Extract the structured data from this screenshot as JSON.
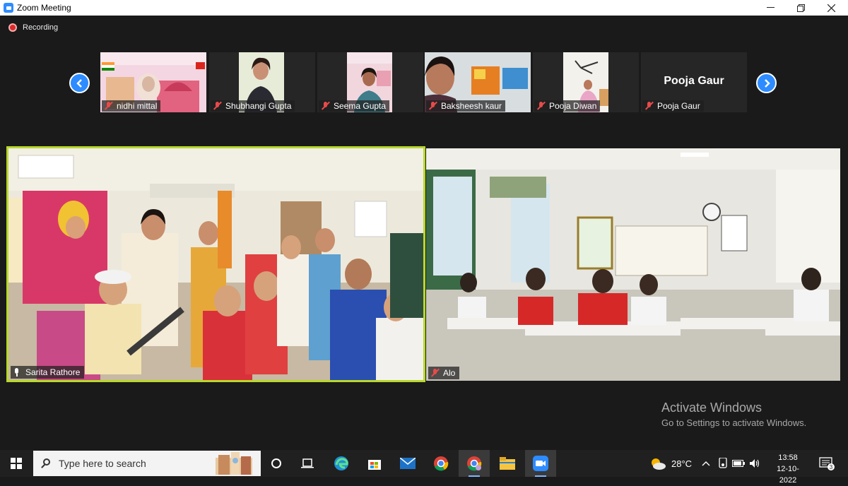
{
  "window": {
    "title": "Zoom Meeting"
  },
  "recording": {
    "label": "Recording"
  },
  "filmstrip": [
    {
      "name": "nidhi mittal"
    },
    {
      "name": "Shubhangi Gupta"
    },
    {
      "name": "Seema Gupta"
    },
    {
      "name": "Baksheesh kaur"
    },
    {
      "name": "Pooja Diwan"
    },
    {
      "name": "Pooja Gaur",
      "video_off_label": "Pooja Gaur"
    }
  ],
  "main": {
    "speaker": {
      "name": "Sarita Rathore",
      "border_color": "#b8d82c"
    },
    "other": {
      "name": "Alo"
    }
  },
  "watermark": {
    "line1": "Activate Windows",
    "line2": "Go to Settings to activate Windows."
  },
  "taskbar": {
    "search_placeholder": "Type here to search",
    "weather": "28°C",
    "time": "13:58",
    "date": "12-10-2022",
    "notifications": "3"
  },
  "colors": {
    "accent": "#2d8cff",
    "recording": "#e02828",
    "active_speaker": "#b8d82c"
  }
}
